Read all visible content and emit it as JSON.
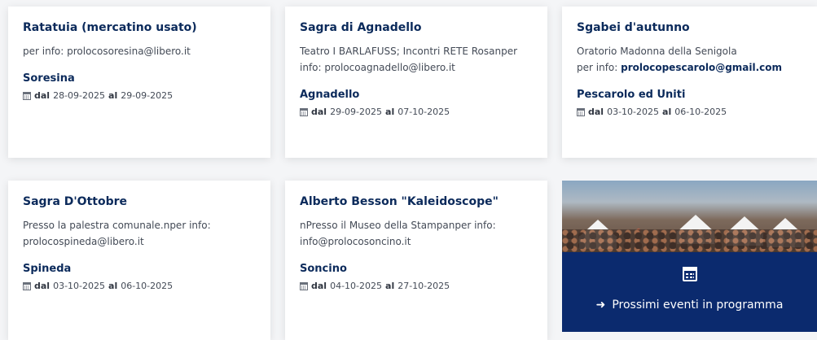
{
  "events": [
    {
      "title": "Ratatuia (mercatino usato)",
      "desc_line1": "per info: prolocosoresina@libero.it",
      "place": "Soresina",
      "dal_label": "dal",
      "date_from": "28-09-2025",
      "al_label": "al",
      "date_to": "29-09-2025"
    },
    {
      "title": "Sagra di Agnadello",
      "desc_line1": "Teatro I BARLAFUSS; Incontri RETE Rosanper",
      "desc_line2": "info: prolocoagnadello@libero.it",
      "place": "Agnadello",
      "dal_label": "dal",
      "date_from": "29-09-2025",
      "al_label": "al",
      "date_to": "07-10-2025"
    },
    {
      "title": "Sgabei d'autunno",
      "desc_line1": "Oratorio Madonna della Senigola",
      "desc_prefix": "per info: ",
      "desc_email": "prolocopescarolo@gmail.com",
      "place": "Pescarolo ed Uniti",
      "dal_label": "dal",
      "date_from": "03-10-2025",
      "al_label": "al",
      "date_to": "06-10-2025"
    },
    {
      "title": "Sagra D'Ottobre",
      "desc_line1": "Presso la palestra comunale.nper info:",
      "desc_line2": "prolocospineda@libero.it",
      "place": "Spineda",
      "dal_label": "dal",
      "date_from": "03-10-2025",
      "al_label": "al",
      "date_to": "06-10-2025"
    },
    {
      "title": "Alberto Besson \"Kaleidoscope\"",
      "desc_line1": "nPresso il Museo della Stampanper info:",
      "desc_line2": "info@prolocosoncino.it",
      "place": "Soncino",
      "dal_label": "dal",
      "date_from": "04-10-2025",
      "al_label": "al",
      "date_to": "27-10-2025"
    }
  ],
  "cta": {
    "label": "Prossimi eventi in programma",
    "arrow_icon": "arrow-right-icon",
    "calendar_icon": "calendar-icon"
  },
  "colors": {
    "title_navy": "#0b2a5b",
    "cta_bg": "#0b2a6e",
    "card_bg": "#ffffff",
    "page_bg": "#f4f5f7"
  }
}
